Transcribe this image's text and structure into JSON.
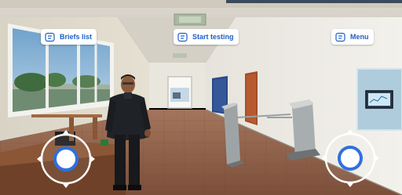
{
  "hud": {
    "briefs_label": "Briefs list",
    "start_label": "Start testing",
    "menu_label": "Menu"
  },
  "icons": {
    "button_icon": "list-card-icon",
    "joystick_arrows": "arrow-triangle-icon"
  },
  "colors": {
    "accent": "#1f5fc8",
    "button_bg": "#ffffff",
    "joystick_knob_ring": "#2f6fe0"
  },
  "scene": {
    "window_display_text": "———"
  }
}
